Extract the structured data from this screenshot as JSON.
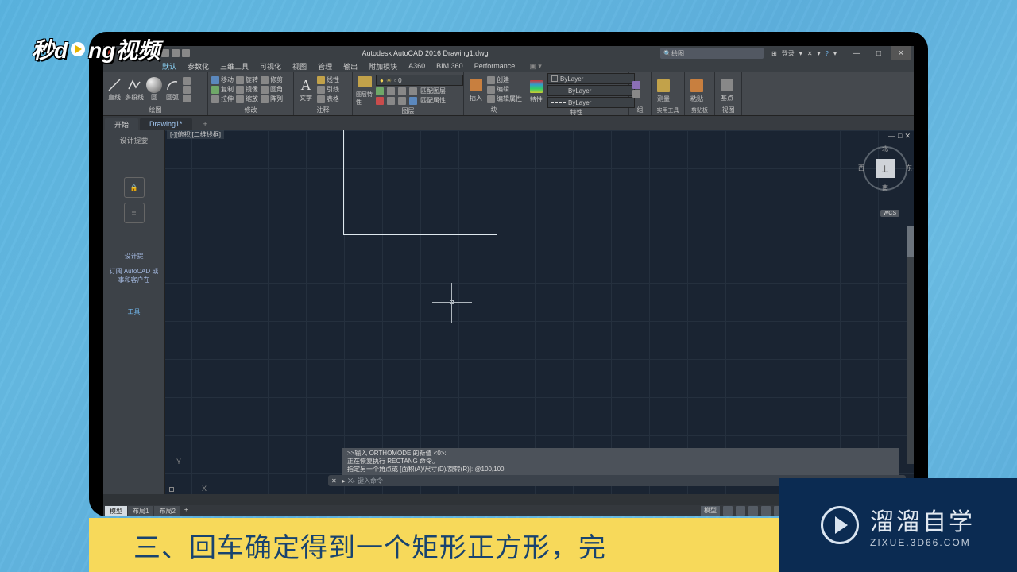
{
  "titlebar": {
    "app_title": "Autodesk AutoCAD 2016    Drawing1.dwg",
    "search_placeholder": "绘图",
    "user_label": "登录",
    "menu_grid": "⊞"
  },
  "menubar": {
    "items": [
      "默认",
      "参数化",
      "三维工具",
      "可视化",
      "视图",
      "管理",
      "输出",
      "附加模块",
      "A360",
      "BIM 360",
      "Performance"
    ]
  },
  "ribbon": {
    "panels": [
      {
        "label": "绘图",
        "big": [
          "直线",
          "多段线",
          "圆",
          "圆弧"
        ]
      },
      {
        "label": "修改",
        "items": [
          "移动",
          "旋转",
          "修剪",
          "复制",
          "镜像",
          "圆角",
          "拉伸",
          "缩放",
          "阵列"
        ]
      },
      {
        "label": "注释",
        "big": [
          "文字"
        ],
        "items": [
          "线性",
          "引线",
          "表格"
        ]
      },
      {
        "label": "图层",
        "big": [
          "图层特性"
        ]
      },
      {
        "label": "块",
        "items": [
          "插入",
          "创建",
          "编辑",
          "编辑属性"
        ]
      },
      {
        "label": "特性",
        "combo1": "ByLayer",
        "combo2": "ByLayer",
        "combo3": "ByLayer",
        "big": "特性"
      },
      {
        "label": "组"
      },
      {
        "label": "实用工具",
        "big": "测量"
      },
      {
        "label": "剪贴板",
        "big": "粘贴"
      },
      {
        "label": "视图",
        "big": "基点"
      }
    ],
    "match_label": "匹配图层",
    "block_extra": "匹配属性"
  },
  "doc_tabs": {
    "start": "开始",
    "active": "Drawing1*",
    "plus": "+"
  },
  "palette": {
    "title": "设计提要",
    "heading": "设计提",
    "sub": "订阅 AutoCAD 或\n事和客户在",
    "link": "工具"
  },
  "view_label": "[-][俯视][二维线框]",
  "ucs": {
    "x": "X",
    "y": "Y"
  },
  "viewcube": {
    "top": "上",
    "n": "北",
    "s": "南",
    "e": "东",
    "w": "西",
    "wcs": "WCS"
  },
  "cmdhist": {
    "l1": ">>输入 ORTHOMODE 的新值 <0>:",
    "l2": "正在恢复执行 RECTANG 命令。",
    "l3": "指定另一个角点或 [面积(A)/尺寸(D)/旋转(R)]: @100,100"
  },
  "cmdline": {
    "prompt": "⨉▸  键入命令"
  },
  "status": {
    "tabs": [
      "模型",
      "布局1",
      "布局2"
    ],
    "plus": "+",
    "model_btn": "模型"
  },
  "subtitle": "三、回车确定得到一个矩形正方形，完",
  "brand": {
    "cn": "溜溜自学",
    "en": "ZIXUE.3D66.COM"
  },
  "logo": {
    "a": "秒d",
    "b": "ng视频"
  }
}
